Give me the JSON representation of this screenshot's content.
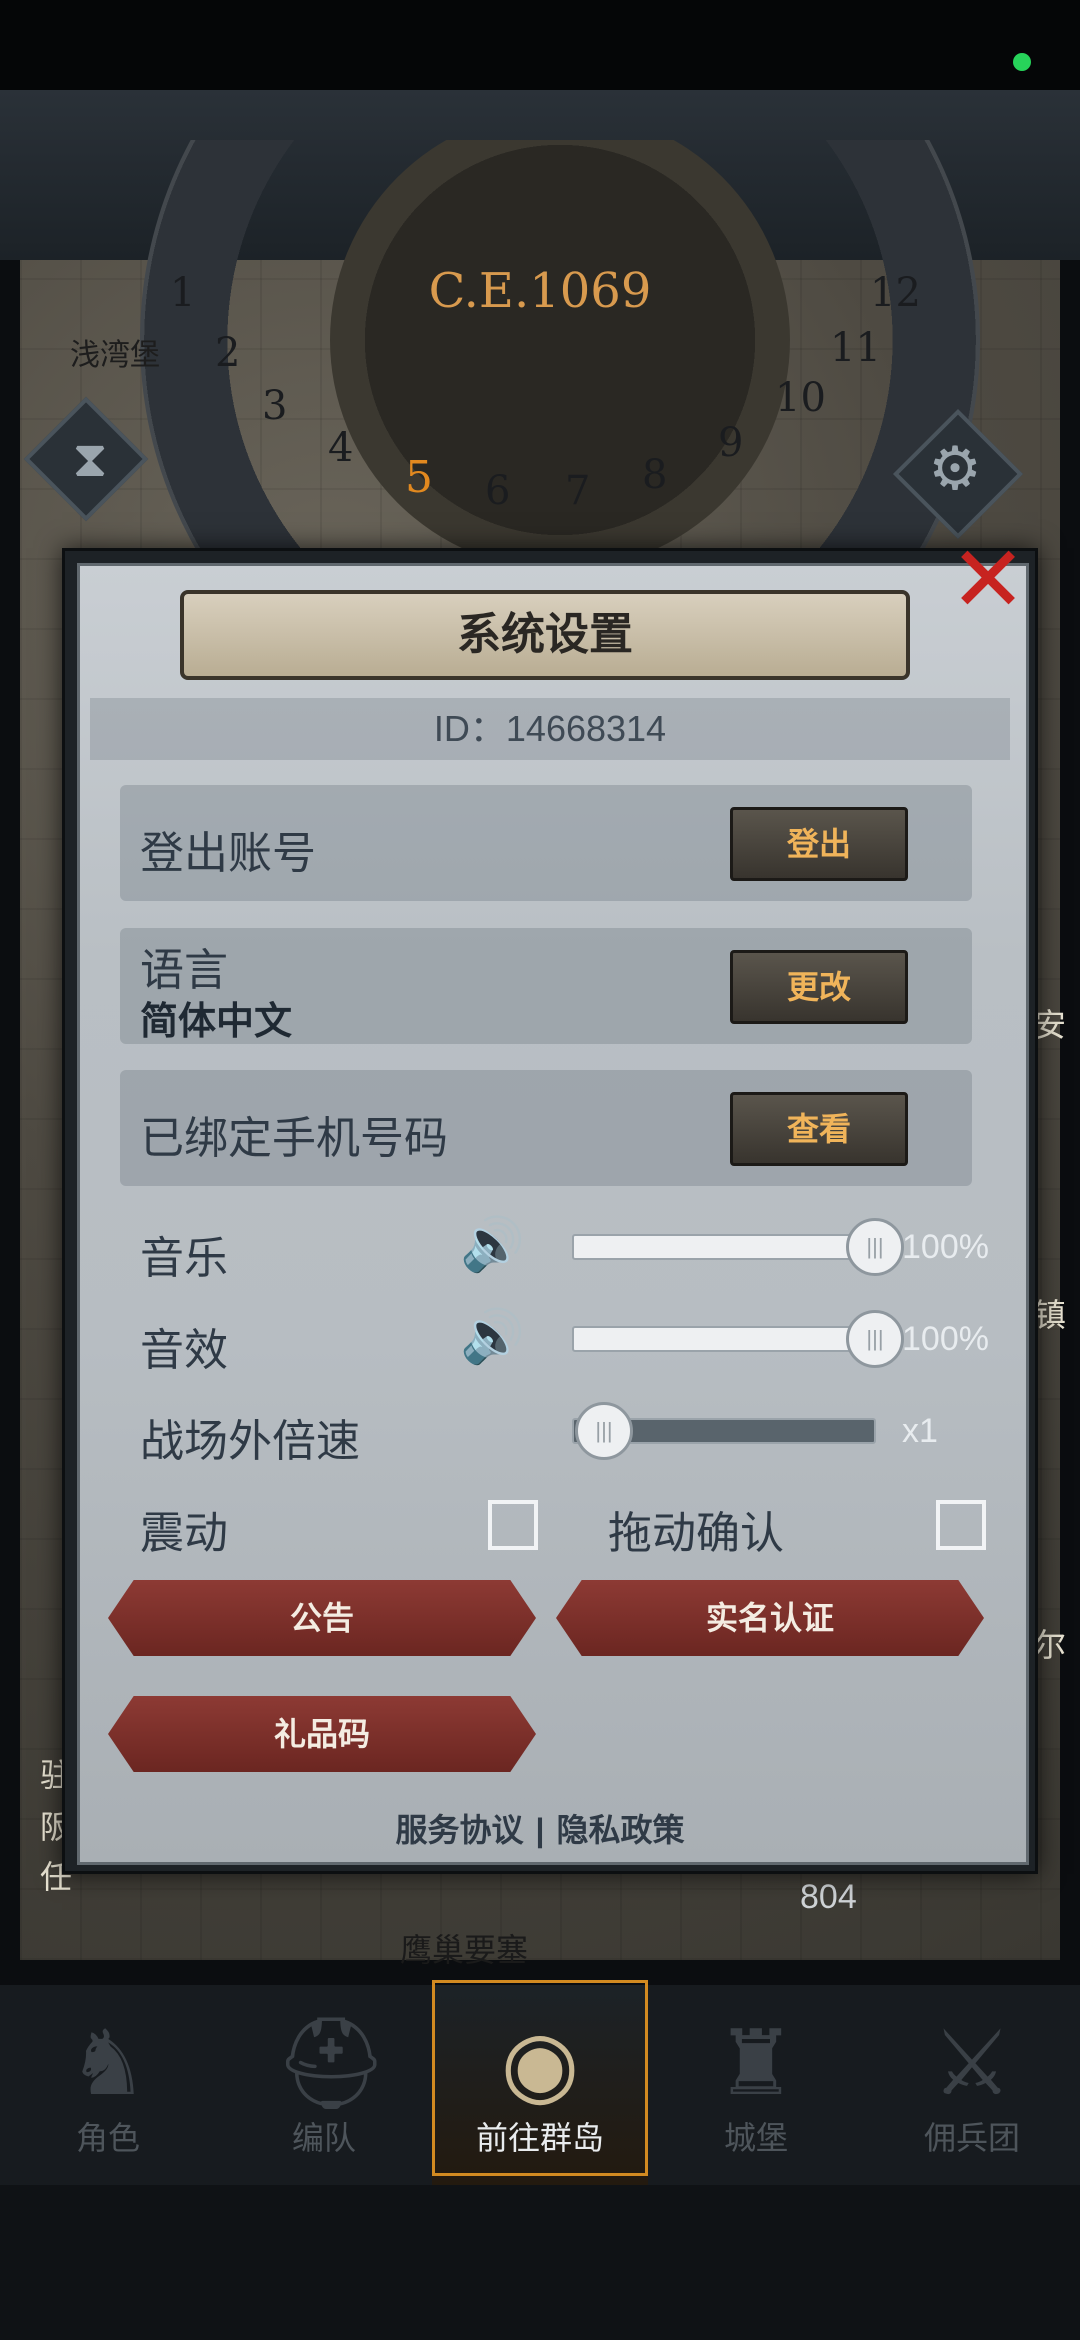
{
  "map": {
    "year": "C.E.1069",
    "months": [
      "1",
      "2",
      "3",
      "4",
      "5",
      "6",
      "7",
      "8",
      "9",
      "10",
      "11",
      "12"
    ],
    "current_month": "5",
    "town_name": "浅湾堡",
    "coin_value": "804",
    "bottom_place": "鹰巢要塞",
    "left_tags": [
      "驻",
      "阪",
      "任"
    ],
    "right_tags": [
      "安",
      "镇",
      "尔"
    ]
  },
  "dialog": {
    "title": "系统设置",
    "id_text": "ID：14668314",
    "logout": {
      "label": "登出账号",
      "button": "登出"
    },
    "language": {
      "label": "语言",
      "value": "简体中文",
      "button": "更改"
    },
    "phone": {
      "label": "已绑定手机号码",
      "button": "查看"
    },
    "music": {
      "label": "音乐",
      "percent": "100%",
      "level": 1.0
    },
    "sfx": {
      "label": "音效",
      "percent": "100%",
      "level": 1.0
    },
    "speed": {
      "label": "战场外倍速",
      "value": "x1",
      "level": 0.0
    },
    "vibration": {
      "label": "震动",
      "checked": false
    },
    "drag_confirm": {
      "label": "拖动确认",
      "checked": false
    },
    "buttons": {
      "notice": "公告",
      "realname": "实名认证",
      "giftcode": "礼品码"
    },
    "links": {
      "terms": "服务协议",
      "separator": "|",
      "privacy": "隐私政策"
    }
  },
  "nav": {
    "items": [
      {
        "label": "角色",
        "icon": "knight-icon"
      },
      {
        "label": "编队",
        "icon": "helmet-icon"
      },
      {
        "label": "前往群岛",
        "icon": "globe-icon"
      },
      {
        "label": "城堡",
        "icon": "castle-icon"
      },
      {
        "label": "佣兵团",
        "icon": "mercenary-icon"
      }
    ],
    "active_index": 2
  },
  "colors": {
    "accent_orange": "#e2891f",
    "close_red": "#c72320",
    "button_red": "#8d3a34"
  }
}
